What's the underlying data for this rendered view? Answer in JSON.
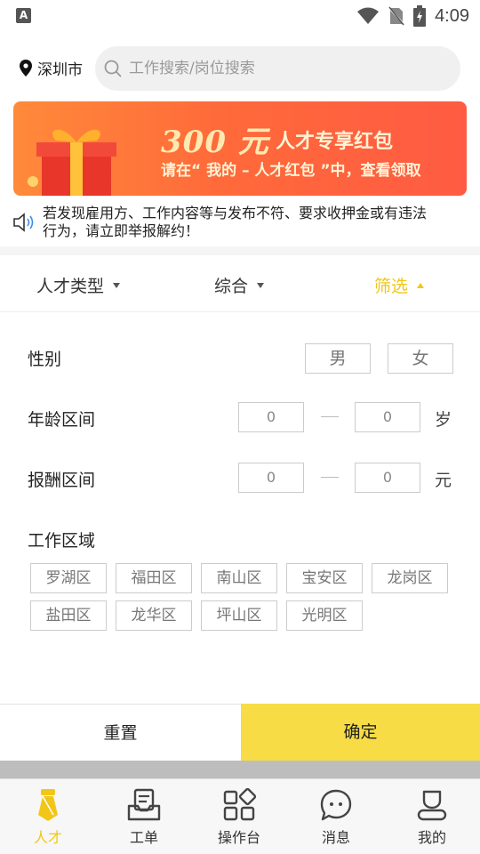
{
  "status_bar": {
    "app_badge": "A",
    "time": "4:09"
  },
  "header": {
    "city": "深圳市",
    "search_placeholder": "工作搜索/岗位搜索"
  },
  "banner": {
    "amount": "300 元",
    "title": "人才专享红包",
    "subtitle": "请在“ 我的 – 人才红包 ”中，查看领取"
  },
  "notice": {
    "line1": "若发现雇用方、工作内容等与发布不符、要求收押金或有违法",
    "line2": "行为，请立即举报解约！"
  },
  "tabs": [
    {
      "label": "人才类型",
      "active": false
    },
    {
      "label": "综合",
      "active": false
    },
    {
      "label": "筛选",
      "active": true
    }
  ],
  "filter": {
    "gender_label": "性别",
    "gender_options": [
      "男",
      "女"
    ],
    "age_label": "年龄区间",
    "age_min": "0",
    "age_max": "0",
    "age_unit": "岁",
    "pay_label": "报酬区间",
    "pay_min": "0",
    "pay_max": "0",
    "pay_unit": "元",
    "area_label": "工作区域",
    "areas": [
      "罗湖区",
      "福田区",
      "南山区",
      "宝安区",
      "龙岗区",
      "盐田区",
      "龙华区",
      "坪山区",
      "光明区"
    ]
  },
  "actions": {
    "reset": "重置",
    "confirm": "确定"
  },
  "bottom_nav": [
    {
      "label": "人才",
      "icon": "tie-icon",
      "active": true
    },
    {
      "label": "工单",
      "icon": "document-tray-icon",
      "active": false
    },
    {
      "label": "操作台",
      "icon": "grid-icon",
      "active": false
    },
    {
      "label": "消息",
      "icon": "chat-bubble-icon",
      "active": false
    },
    {
      "label": "我的",
      "icon": "user-icon",
      "active": false
    }
  ],
  "colors": {
    "accent": "#f2c617",
    "confirm_bg": "#f7dc45",
    "banner_start": "#ff8a3a",
    "banner_end": "#ff5b43"
  }
}
